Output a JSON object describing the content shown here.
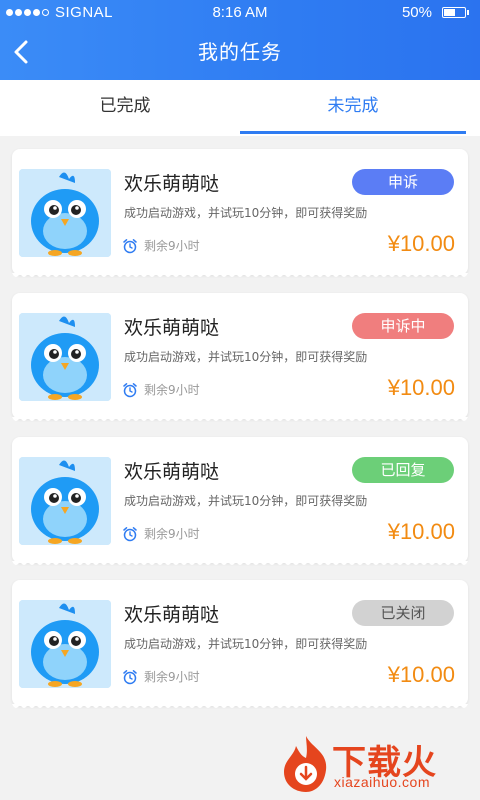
{
  "status_bar": {
    "carrier": "SIGNAL",
    "time": "8:16  AM",
    "battery": "50%"
  },
  "header": {
    "title": "我的任务",
    "back_icon": "chevron-left-icon"
  },
  "tabs": [
    {
      "label": "已完成",
      "active": false
    },
    {
      "label": "未完成",
      "active": true
    }
  ],
  "tasks": [
    {
      "name": "欢乐萌萌哒",
      "description": "成功启动游戏，并试玩10分钟，即可获得奖励",
      "time_left": "剩余9小时",
      "reward": "¥10.00",
      "status": "申诉",
      "status_color": "#5b7df5"
    },
    {
      "name": "欢乐萌萌哒",
      "description": "成功启动游戏，并试玩10分钟，即可获得奖励",
      "time_left": "剩余9小时",
      "reward": "¥10.00",
      "status": "申诉中",
      "status_color": "#f07e7e"
    },
    {
      "name": "欢乐萌萌哒",
      "description": "成功启动游戏，并试玩10分钟，即可获得奖励",
      "time_left": "剩余9小时",
      "reward": "¥10.00",
      "status": "已回复",
      "status_color": "#6ccf78"
    },
    {
      "name": "欢乐萌萌哒",
      "description": "成功启动游戏，并试玩10分钟，即可获得奖励",
      "time_left": "剩余9小时",
      "reward": "¥10.00",
      "status": "已关闭",
      "status_color": "#d2d2d2",
      "status_text_color": "#555555"
    }
  ],
  "watermark": {
    "text": "下载火",
    "url": "xiazaihuo.com"
  },
  "colors": {
    "accent": "#2f7cf2",
    "price": "#f28b12"
  }
}
